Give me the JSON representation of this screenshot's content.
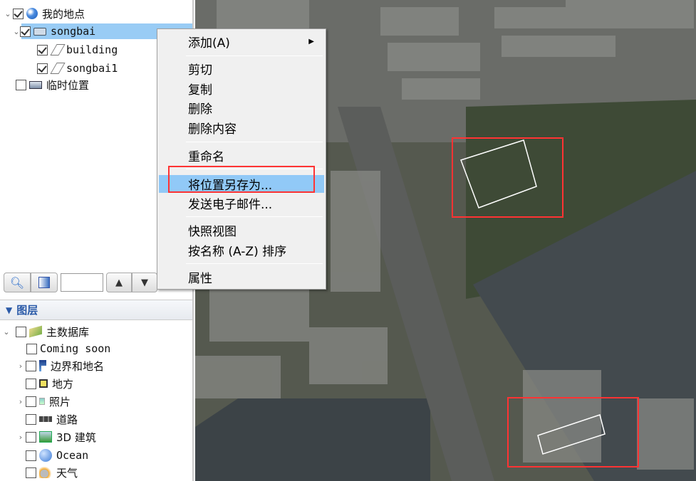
{
  "places": {
    "root": {
      "label": "我的地点",
      "checked": true,
      "icon": "google-earth-icon"
    },
    "folder": {
      "label": "songbai",
      "checked": true,
      "icon": "open-folder-icon",
      "selected": true
    },
    "children": [
      {
        "label": "building",
        "checked": true,
        "icon": "polygon-icon"
      },
      {
        "label": "songbai1",
        "checked": true,
        "icon": "polygon-icon"
      }
    ],
    "temp": {
      "label": "临时位置",
      "checked": false,
      "icon": "folder-icon"
    }
  },
  "toolbar": {
    "search_icon": "search-icon",
    "panel_icon": "panel-icon",
    "input_value": "",
    "up": "▲",
    "down": "▼"
  },
  "layers": {
    "header": "图层",
    "root": {
      "label": "主数据库",
      "checked": false
    },
    "items": [
      {
        "label": "Coming soon",
        "icon": "none",
        "expandable": false
      },
      {
        "label": "边界和地名",
        "icon": "flag-icon",
        "expandable": true
      },
      {
        "label": "地方",
        "icon": "place-icon",
        "expandable": false
      },
      {
        "label": "照片",
        "icon": "photo-icon",
        "expandable": true
      },
      {
        "label": "道路",
        "icon": "road-icon",
        "expandable": false
      },
      {
        "label": "3D 建筑",
        "icon": "building-3d-icon",
        "expandable": true
      },
      {
        "label": "Ocean",
        "icon": "ocean-globe-icon",
        "expandable": false
      },
      {
        "label": "天气",
        "icon": "weather-icon",
        "expandable": false
      }
    ]
  },
  "context_menu": {
    "items": [
      {
        "label": "添加(A)",
        "submenu": true
      },
      {
        "label": "剪切"
      },
      {
        "label": "复制"
      },
      {
        "label": "删除"
      },
      {
        "label": "删除内容"
      },
      {
        "label": "重命名"
      },
      {
        "label": "将位置另存为...",
        "highlighted": true
      },
      {
        "label": "发送电子邮件..."
      },
      {
        "label": "快照视图"
      },
      {
        "label": "按名称 (A-Z) 排序"
      },
      {
        "label": "属性"
      }
    ]
  },
  "colors": {
    "selection": "#99ccf5",
    "menu_highlight": "#91c9f7",
    "annotation": "#ff3333"
  }
}
